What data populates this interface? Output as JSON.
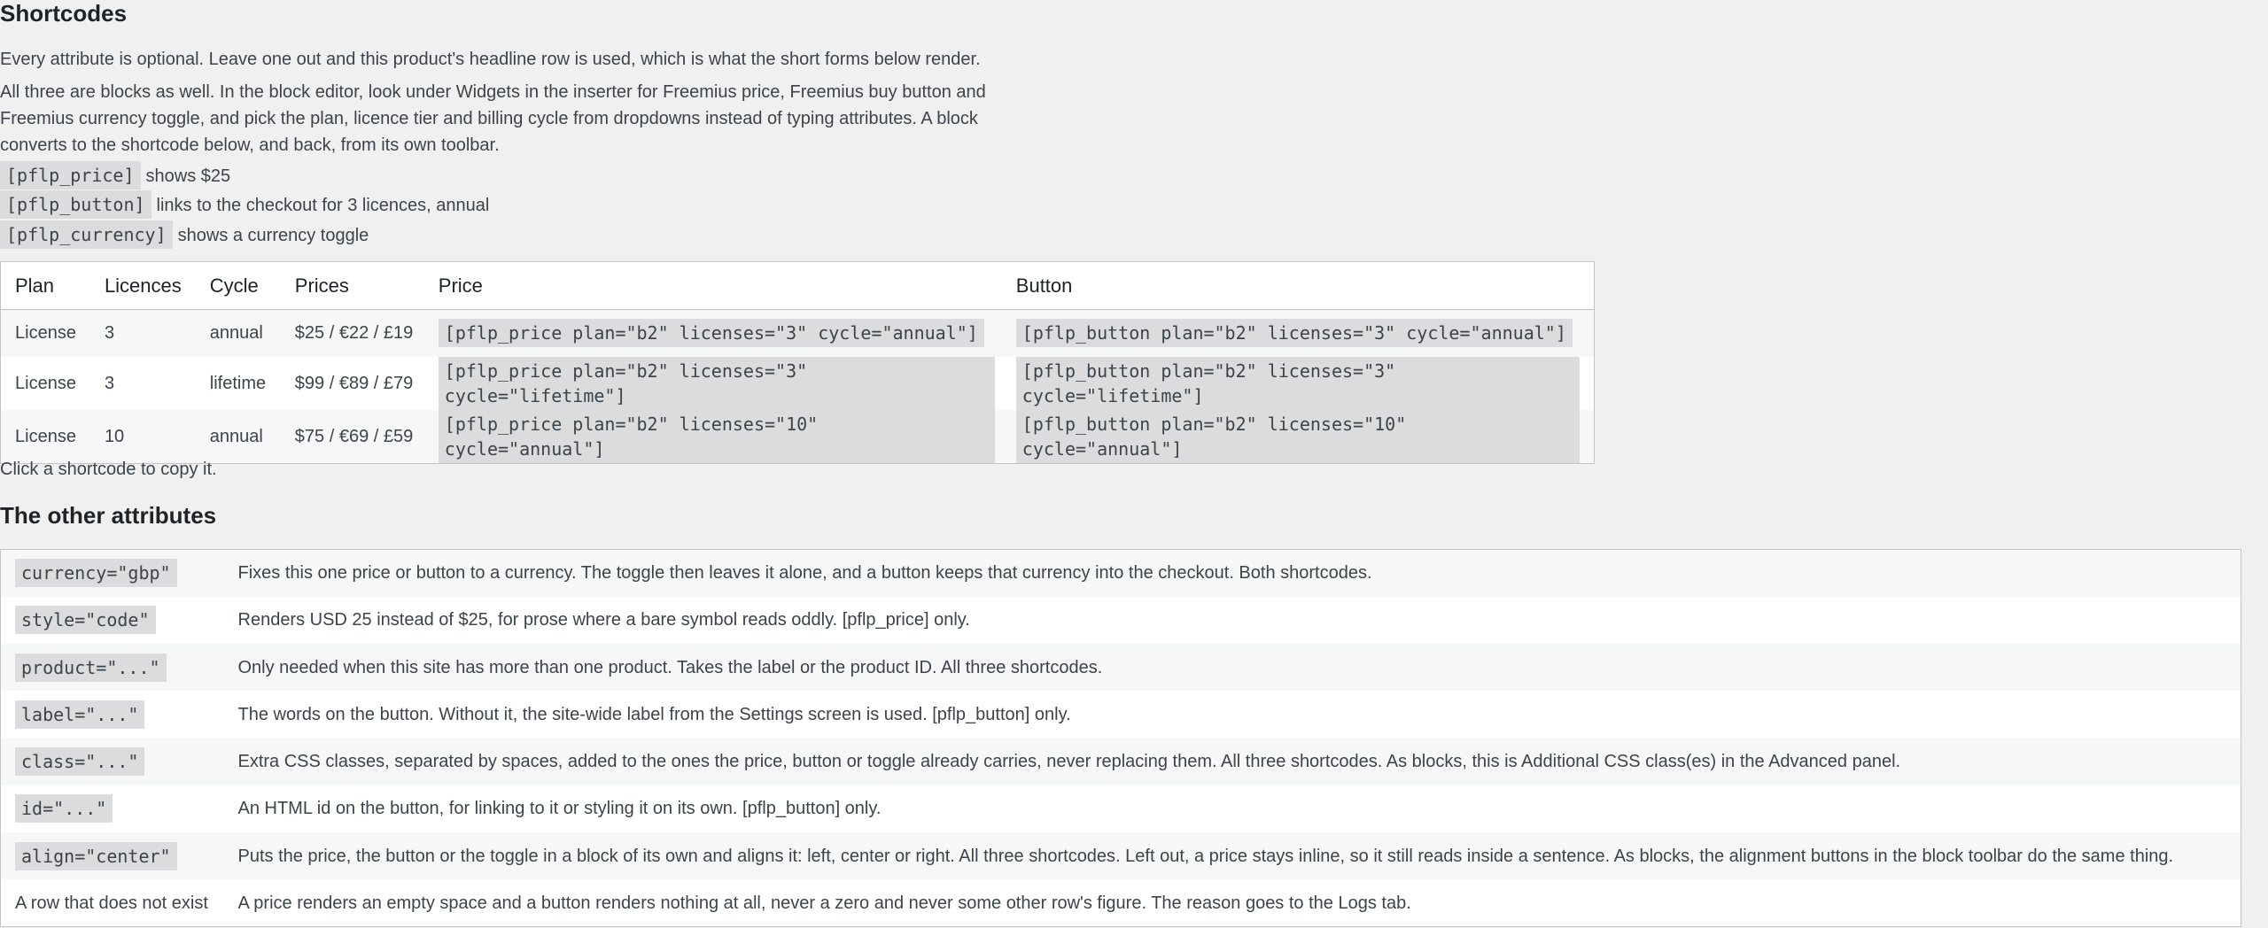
{
  "shortcodes_section": {
    "title": "Shortcodes",
    "intro": "Every attribute is optional. Leave one out and this product's headline row is used, which is what the short forms below render.",
    "blocks_note": "All three are blocks as well. In the block editor, look under Widgets in the inserter for Freemius price, Freemius buy button and Freemius currency toggle, and pick the plan, licence tier and billing cycle from dropdowns instead of typing attributes. A block converts to the shortcode below, and back, from its own toolbar.",
    "short_forms": [
      {
        "code": "[pflp_price]",
        "desc": "shows $25"
      },
      {
        "code": "[pflp_button]",
        "desc": "links to the checkout for 3 licences, annual"
      },
      {
        "code": "[pflp_currency]",
        "desc": "shows a currency toggle"
      }
    ],
    "table": {
      "headers": {
        "plan": "Plan",
        "licences": "Licences",
        "cycle": "Cycle",
        "prices": "Prices",
        "price": "Price",
        "button": "Button"
      },
      "rows": [
        {
          "plan": "License",
          "licences": "3",
          "cycle": "annual",
          "prices": "$25 / €22 / £19",
          "price_code": "[pflp_price plan=\"b2\" licenses=\"3\" cycle=\"annual\"]",
          "button_code": "[pflp_button plan=\"b2\" licenses=\"3\" cycle=\"annual\"]"
        },
        {
          "plan": "License",
          "licences": "3",
          "cycle": "lifetime",
          "prices": "$99 / €89 / £79",
          "price_code": "[pflp_price plan=\"b2\" licenses=\"3\" cycle=\"lifetime\"]",
          "button_code": "[pflp_button plan=\"b2\" licenses=\"3\" cycle=\"lifetime\"]"
        },
        {
          "plan": "License",
          "licences": "10",
          "cycle": "annual",
          "prices": "$75 / €69 / £59",
          "price_code": "[pflp_price plan=\"b2\" licenses=\"10\" cycle=\"annual\"]",
          "button_code": "[pflp_button plan=\"b2\" licenses=\"10\" cycle=\"annual\"]"
        }
      ]
    },
    "copy_hint": "Click a shortcode to copy it."
  },
  "other_attributes": {
    "title": "The other attributes",
    "rows": [
      {
        "key": "currency=\"gbp\"",
        "is_code": true,
        "desc": "Fixes this one price or button to a currency. The toggle then leaves it alone, and a button keeps that currency into the checkout. Both shortcodes."
      },
      {
        "key": "style=\"code\"",
        "is_code": true,
        "desc": "Renders USD 25 instead of $25, for prose where a bare symbol reads oddly. [pflp_price] only."
      },
      {
        "key": "product=\"...\"",
        "is_code": true,
        "desc": "Only needed when this site has more than one product. Takes the label or the product ID. All three shortcodes."
      },
      {
        "key": "label=\"...\"",
        "is_code": true,
        "desc": "The words on the button. Without it, the site-wide label from the Settings screen is used. [pflp_button] only."
      },
      {
        "key": "class=\"...\"",
        "is_code": true,
        "desc": "Extra CSS classes, separated by spaces, added to the ones the price, button or toggle already carries, never replacing them. All three shortcodes. As blocks, this is Additional CSS class(es) in the Advanced panel."
      },
      {
        "key": "id=\"...\"",
        "is_code": true,
        "desc": "An HTML id on the button, for linking to it or styling it on its own. [pflp_button] only."
      },
      {
        "key": "align=\"center\"",
        "is_code": true,
        "desc": "Puts the price, the button or the toggle in a block of its own and aligns it: left, center or right. All three shortcodes. Left out, a price stays inline, so it still reads inside a sentence. As blocks, the alignment buttons in the block toolbar do the same thing."
      },
      {
        "key": "A row that does not exist",
        "is_code": false,
        "desc": "A price renders an empty space and a button renders nothing at all, never a zero and never some other row's figure. The reason goes to the Logs tab."
      }
    ]
  }
}
